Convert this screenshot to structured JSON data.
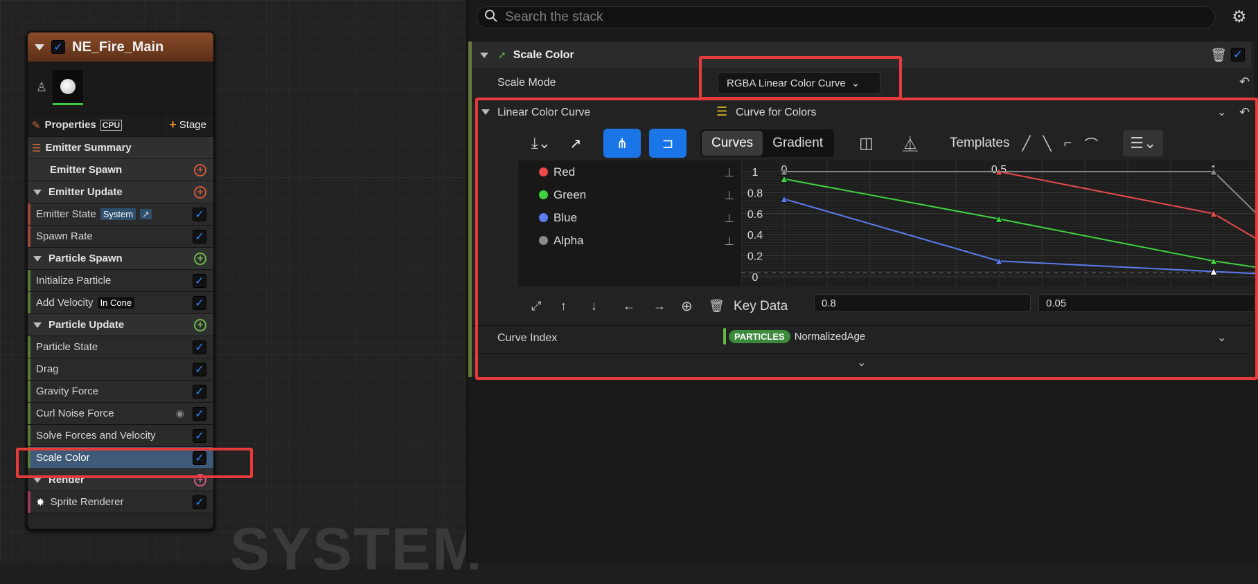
{
  "node": {
    "title": "NE_Fire_Main",
    "properties_label": "Properties",
    "cpu_label": "CPU",
    "stage_label": "Stage",
    "emitter_summary": "Emitter Summary",
    "emitter_spawn": "Emitter Spawn",
    "emitter_update": "Emitter Update",
    "emitter_state": "Emitter State",
    "system_tag": "System",
    "spawn_rate": "Spawn Rate",
    "particle_spawn": "Particle Spawn",
    "initialize_particle": "Initialize Particle",
    "add_velocity": "Add Velocity",
    "in_cone_tag": "In Cone",
    "particle_update": "Particle Update",
    "particle_state": "Particle State",
    "drag": "Drag",
    "gravity_force": "Gravity Force",
    "curl_noise_force": "Curl Noise Force",
    "solve_forces": "Solve Forces and Velocity",
    "scale_color": "Scale Color",
    "render": "Render",
    "sprite_renderer": "Sprite Renderer"
  },
  "watermark": "SYSTEM",
  "panel": {
    "search_placeholder": "Search the stack",
    "module_title": "Scale Color",
    "scale_mode_label": "Scale Mode",
    "scale_mode_value": "RGBA Linear Color Curve",
    "linear_color_curve": "Linear Color Curve",
    "curve_for_colors": "Curve for Colors",
    "toggle": [
      "Curves",
      "Gradient"
    ],
    "templates_label": "Templates",
    "channels": [
      {
        "name": "Red",
        "color": "#e84a4a"
      },
      {
        "name": "Green",
        "color": "#3fd33f"
      },
      {
        "name": "Blue",
        "color": "#5b7cf0"
      },
      {
        "name": "Alpha",
        "color": "#8a8a8a"
      }
    ],
    "key_data_label": "Key Data",
    "key_time": "0.8",
    "key_value": "0.05",
    "curve_index_label": "Curve Index",
    "particles_tag": "PARTICLES",
    "normalized_age": "NormalizedAge"
  },
  "chart_data": {
    "type": "line",
    "x_tick_labels": [
      "0",
      "0.5",
      "1"
    ],
    "y_tick_labels": [
      "1",
      "0.8",
      "0.6",
      "0.4",
      "0.2",
      "0"
    ],
    "xlim": [
      0,
      1.25
    ],
    "ylim": [
      0,
      1
    ],
    "series": [
      {
        "name": "Red",
        "color": "#e84a4a",
        "x": [
          0,
          0.5,
          1.0,
          1.25
        ],
        "y": [
          1.0,
          1.0,
          0.6,
          0.0
        ]
      },
      {
        "name": "Green",
        "color": "#3fd33f",
        "x": [
          0,
          0.5,
          1.0,
          1.25
        ],
        "y": [
          0.93,
          0.55,
          0.15,
          0.0
        ]
      },
      {
        "name": "Blue",
        "color": "#5b7cf0",
        "x": [
          0,
          0.5,
          1.0,
          1.25
        ],
        "y": [
          0.74,
          0.15,
          0.05,
          0.0
        ]
      },
      {
        "name": "Alpha",
        "color": "#8a8a8a",
        "x": [
          0,
          1.0,
          1.25
        ],
        "y": [
          1.0,
          1.0,
          0.0
        ]
      }
    ]
  }
}
